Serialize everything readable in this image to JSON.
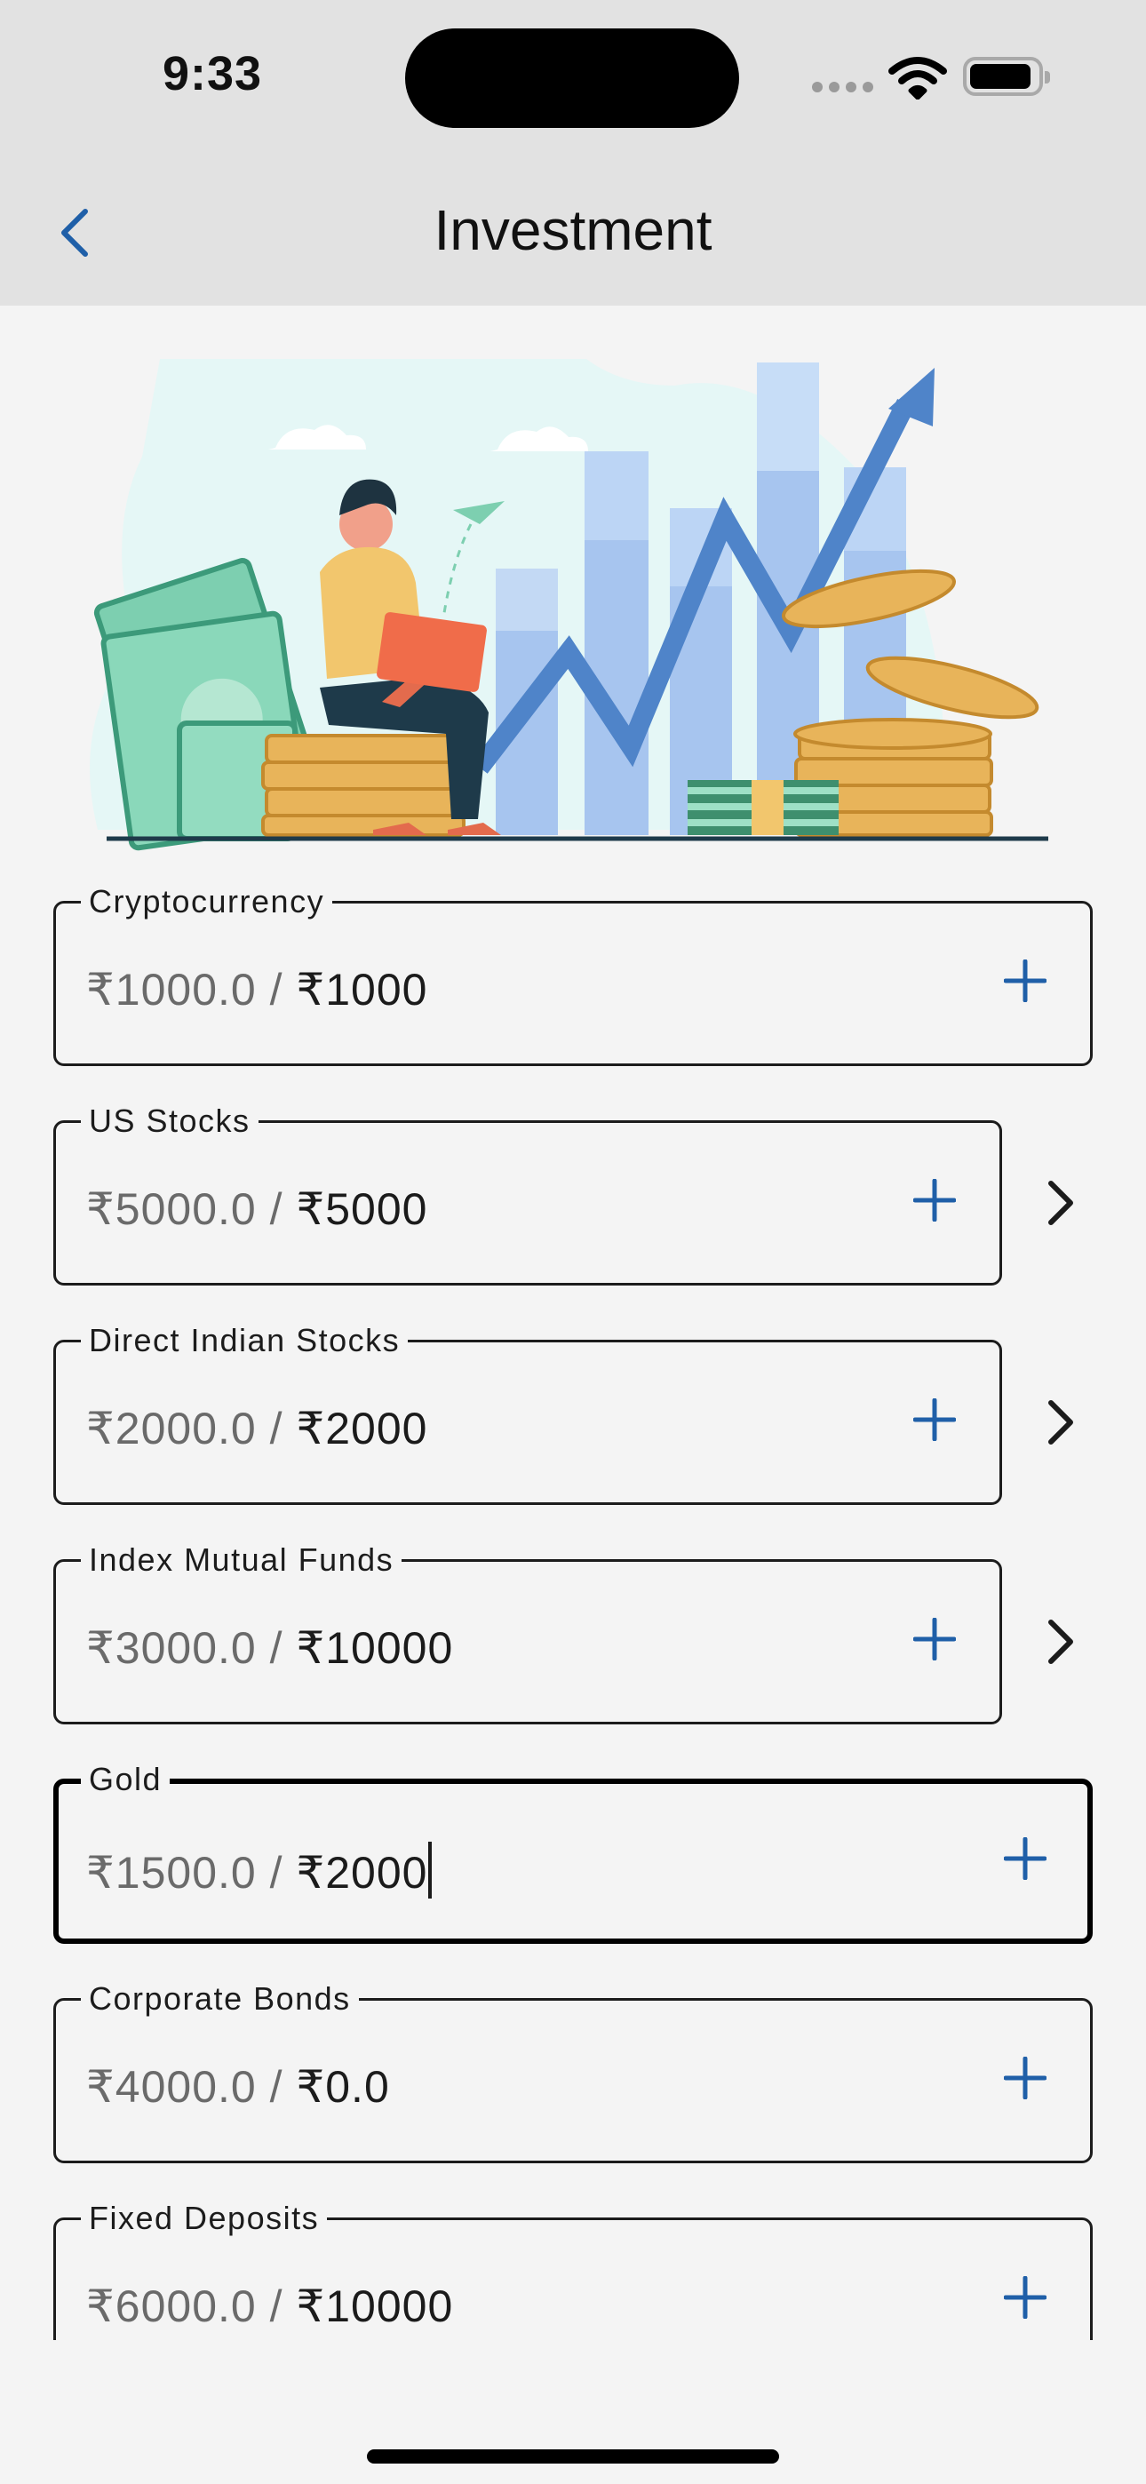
{
  "status_bar": {
    "time": "9:33"
  },
  "header": {
    "title": "Investment"
  },
  "fields": [
    {
      "label": "Cryptocurrency",
      "current": "₹1000.0",
      "separator": " / ",
      "target": "₹1000"
    },
    {
      "label": "US Stocks",
      "current": "₹5000.0",
      "separator": " / ",
      "target": "₹5000"
    },
    {
      "label": "Direct Indian Stocks",
      "current": "₹2000.0",
      "separator": " / ",
      "target": "₹2000"
    },
    {
      "label": "Index Mutual Funds",
      "current": "₹3000.0",
      "separator": " / ",
      "target": "₹10000"
    },
    {
      "label": "Gold",
      "current": "₹1500.0",
      "separator": " / ",
      "target": "₹2000"
    },
    {
      "label": "Corporate Bonds",
      "current": "₹4000.0",
      "separator": " / ",
      "target": "₹0.0"
    },
    {
      "label": "Fixed Deposits",
      "current": "₹6000.0",
      "separator": " / ",
      "target": "₹10000"
    }
  ],
  "colors": {
    "accent": "#1f5fa8",
    "header_bg": "#e2e2e2",
    "page_bg": "#f4f4f4"
  },
  "icons": {
    "back": "chevron-left-icon",
    "add": "plus-icon",
    "navigate": "chevron-right-icon"
  }
}
